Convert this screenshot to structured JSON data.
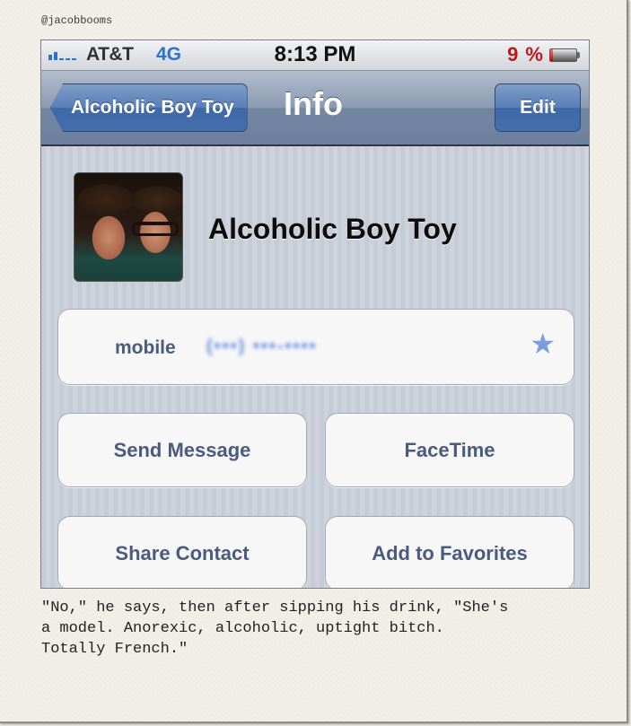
{
  "polaroid": {
    "handle": "@jacobbooms",
    "caption": "\"No,\" he says, then after sipping his drink, \"She's\na model. Anorexic, alcoholic, uptight bitch.\nTotally French.\""
  },
  "status_bar": {
    "signal_bars_filled": 2,
    "signal_bars_total": 5,
    "carrier": "AT&T",
    "network": "4G",
    "time": "8:13 PM",
    "battery_percent_label": "9 %",
    "battery_level": 0.09,
    "colors": {
      "network": "#2a74cf",
      "battery_low": "#c0161c"
    }
  },
  "nav_bar": {
    "back_label": "Alcoholic Boy Toy",
    "title": "Info",
    "edit_label": "Edit"
  },
  "contact": {
    "name": "Alcoholic Boy Toy",
    "avatar_icon": "contact-photo",
    "phone": {
      "label": "mobile",
      "value_obscured": "(•••) •••-••••",
      "favorite_icon": "star-icon"
    }
  },
  "actions": [
    {
      "label": "Send Message"
    },
    {
      "label": "FaceTime"
    },
    {
      "label": "Share Contact"
    },
    {
      "label": "Add to Favorites"
    }
  ]
}
